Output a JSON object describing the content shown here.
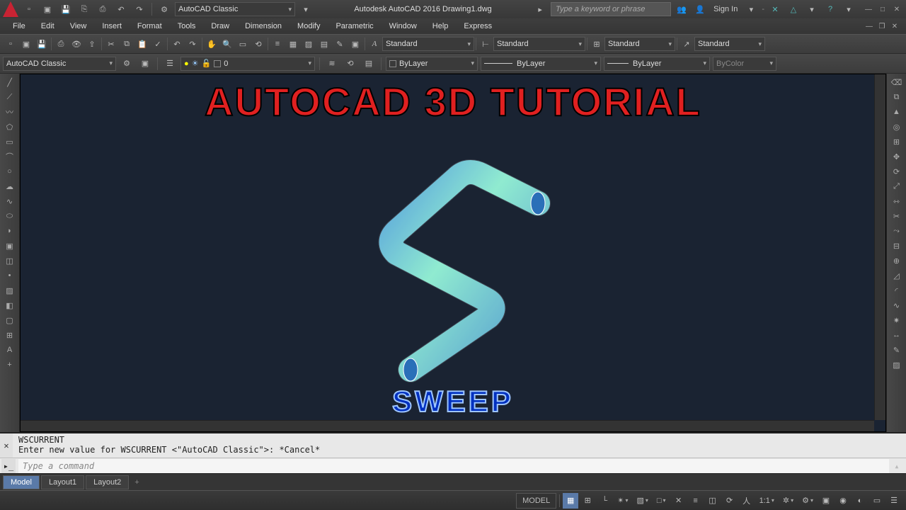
{
  "titlebar": {
    "workspace_dropdown": "AutoCAD Classic",
    "app_title": "Autodesk AutoCAD 2016   Drawing1.dwg",
    "search_placeholder": "Type a keyword or phrase",
    "sign_in": "Sign In"
  },
  "menubar": [
    "File",
    "Edit",
    "View",
    "Insert",
    "Format",
    "Tools",
    "Draw",
    "Dimension",
    "Modify",
    "Parametric",
    "Window",
    "Help",
    "Express"
  ],
  "toolbar1": {
    "style1": "Standard",
    "style2": "Standard",
    "style3": "Standard",
    "style4": "Standard"
  },
  "toolbar2": {
    "workspace": "AutoCAD Classic",
    "layer": "0",
    "prop_color": "ByLayer",
    "prop_linetype": "ByLayer",
    "prop_lineweight": "ByLayer",
    "plot_style": "ByColor"
  },
  "tutorial": {
    "title": "AUTOCAD 3D TUTORIAL",
    "command": "SWEEP"
  },
  "commandline": {
    "line1": "WSCURRENT",
    "line2": "Enter new value for WSCURRENT <\"AutoCAD Classic\">: *Cancel*",
    "placeholder": "Type a command"
  },
  "tabs": {
    "model": "Model",
    "layout1": "Layout1",
    "layout2": "Layout2"
  },
  "statusbar": {
    "model": "MODEL",
    "scale": "1:1"
  }
}
